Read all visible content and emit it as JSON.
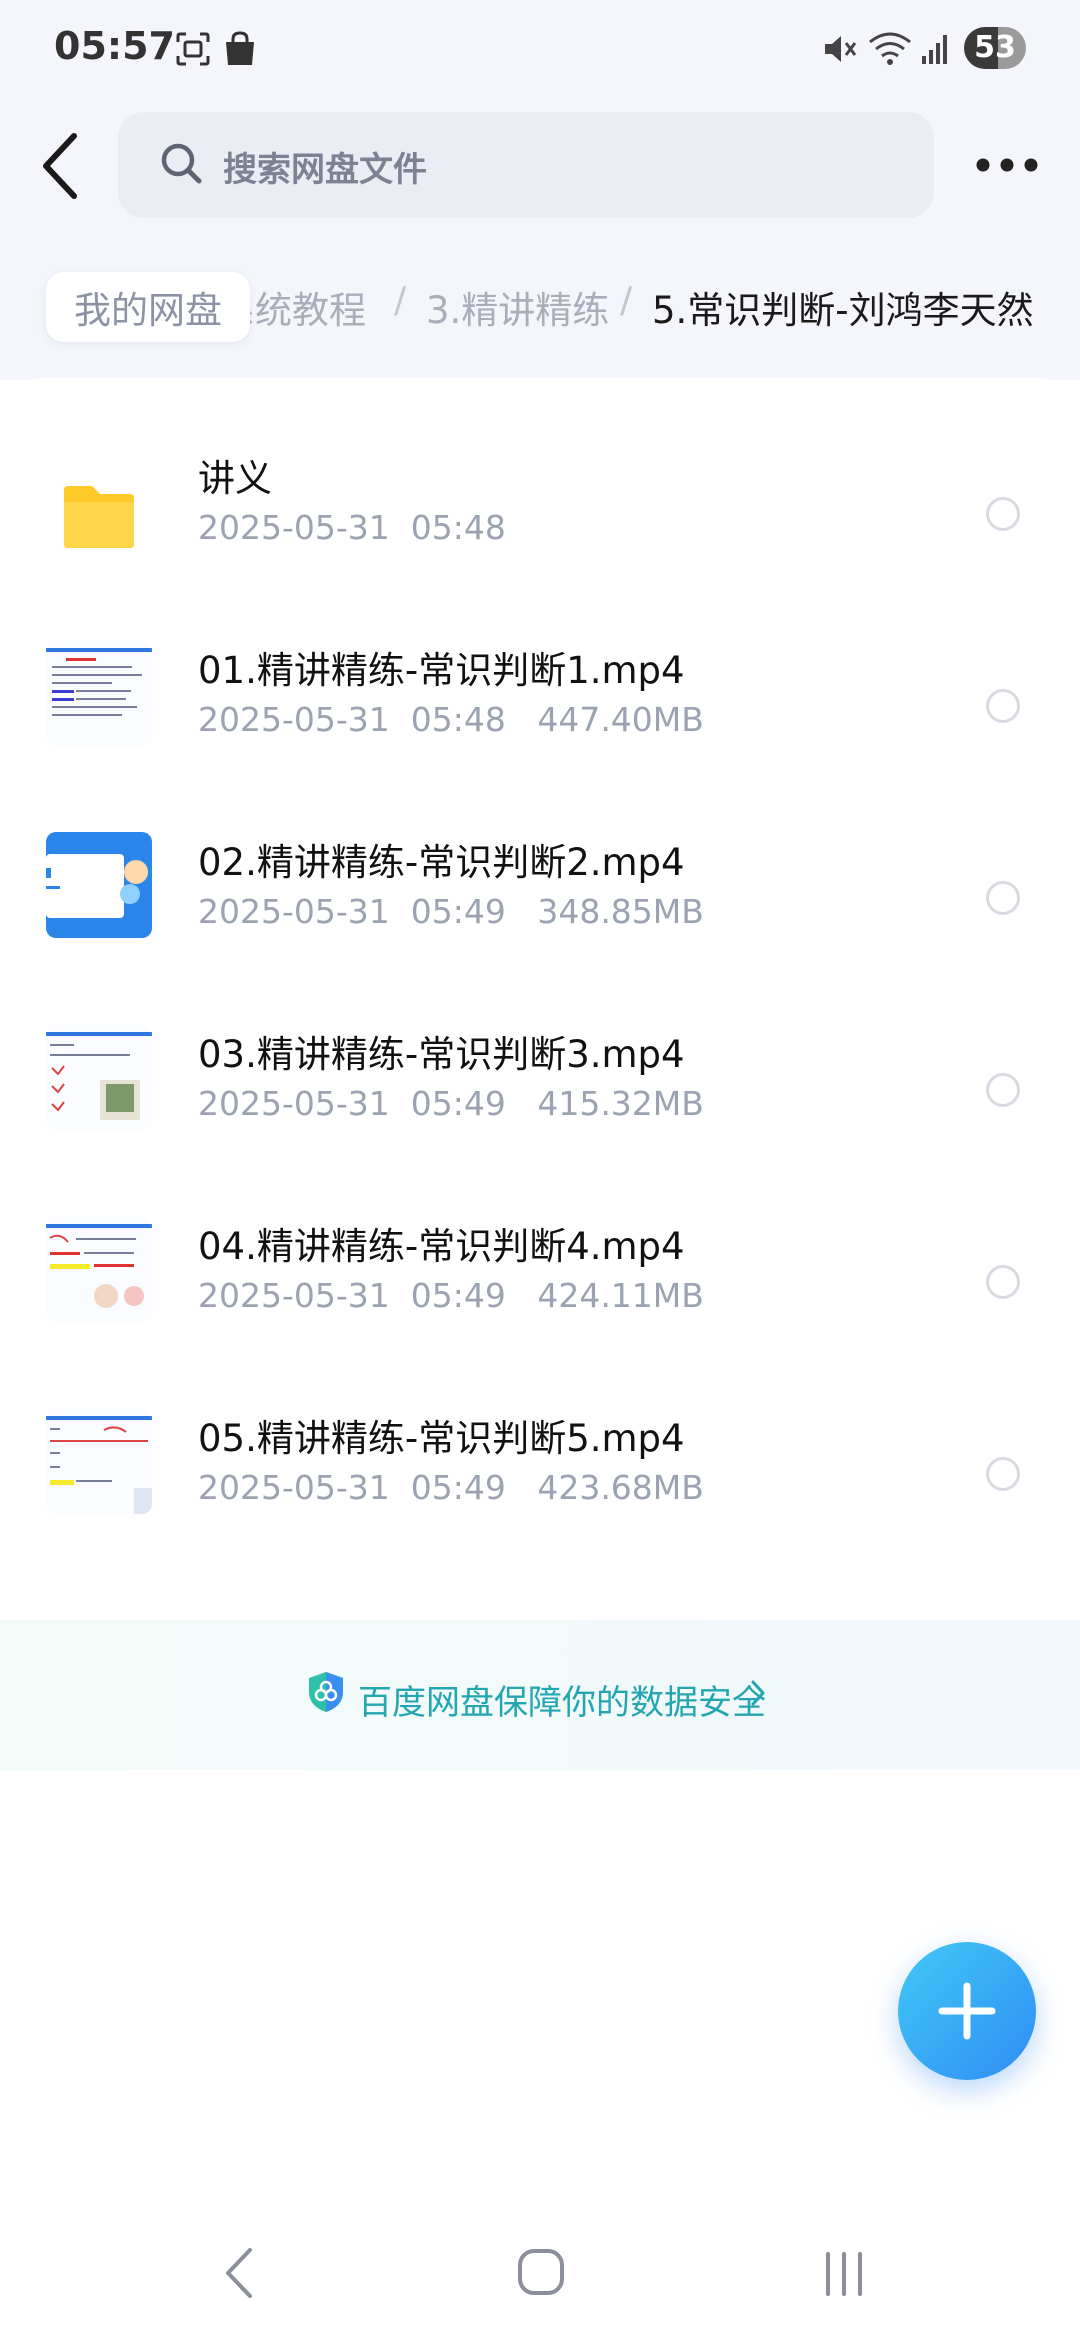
{
  "status_bar": {
    "time": "05:57",
    "battery": "53",
    "icons": [
      "screenshot-icon",
      "shopping-bag-icon",
      "mute-icon",
      "wifi-icon",
      "signal-icon"
    ]
  },
  "header": {
    "search_placeholder": "搜索网盘文件"
  },
  "breadcrumb": {
    "items": [
      "我的网盘",
      "系统教程",
      "3.精讲精练",
      "5.常识判断-刘鸿李天然"
    ],
    "separator": "/"
  },
  "files": [
    {
      "name": "讲义",
      "meta": "2025-05-31  05:48",
      "type": "folder"
    },
    {
      "name": "01.精讲精练-常识判断1.mp4",
      "meta": "2025-05-31  05:48   447.40MB",
      "type": "video"
    },
    {
      "name": "02.精讲精练-常识判断2.mp4",
      "meta": "2025-05-31  05:49   348.85MB",
      "type": "video"
    },
    {
      "name": "03.精讲精练-常识判断3.mp4",
      "meta": "2025-05-31  05:49   415.32MB",
      "type": "video"
    },
    {
      "name": "04.精讲精练-常识判断4.mp4",
      "meta": "2025-05-31  05:49   424.11MB",
      "type": "video"
    },
    {
      "name": "05.精讲精练-常识判断5.mp4",
      "meta": "2025-05-31  05:49   423.68MB",
      "type": "video"
    }
  ],
  "security_banner": {
    "text": "百度网盘保障你的数据安全"
  },
  "colors": {
    "accent": "#2f8cf5",
    "folder": "#ffd54a",
    "security": "#23a6b0"
  }
}
